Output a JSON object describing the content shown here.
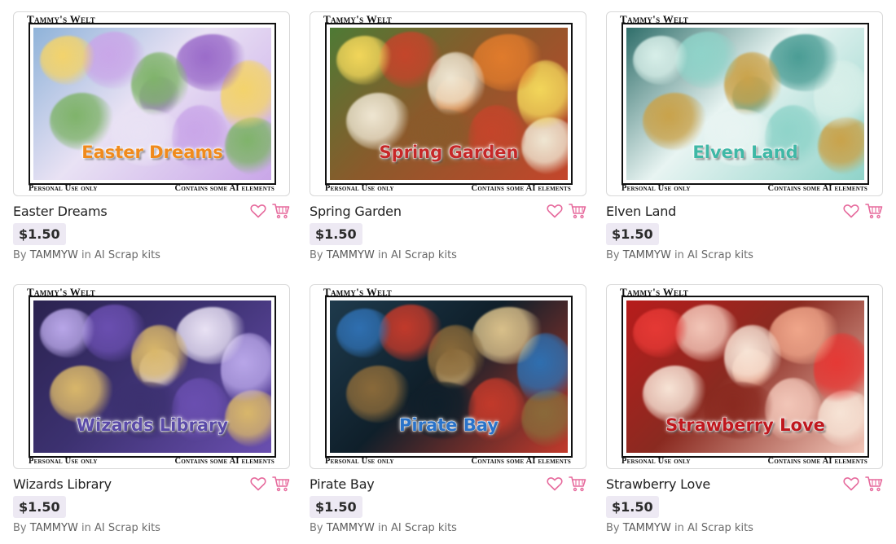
{
  "colors": {
    "accent": "#e6699c",
    "price_bg": "#ede9f3"
  },
  "products": [
    {
      "name": "Easter Dreams",
      "price": "$1.50",
      "by": "By",
      "author": "TAMMYW",
      "in": "in",
      "category": "AI Scrap kits",
      "brand": "Tammy's Welt",
      "note_left": "Personal Use only",
      "note_right": "Contains some AI elements",
      "art_title": "Easter Dreams",
      "art_title_color": "#f08a1c",
      "palette": [
        "#8fb3d9",
        "#c9a6e8",
        "#f3d36b",
        "#7fb36a",
        "#e9e2f4",
        "#9a6bc9"
      ]
    },
    {
      "name": "Spring Garden",
      "price": "$1.50",
      "by": "By",
      "author": "TAMMYW",
      "in": "in",
      "category": "AI Scrap kits",
      "brand": "Tammy's Welt",
      "note_left": "Personal Use only",
      "note_right": "Contains some AI elements",
      "art_title": "Spring Garden",
      "art_title_color": "#c62828",
      "palette": [
        "#4e7a35",
        "#c4452b",
        "#f2d65a",
        "#efe6d2",
        "#8a5a2b",
        "#e07b2c"
      ]
    },
    {
      "name": "Elven Land",
      "price": "$1.50",
      "by": "By",
      "author": "TAMMYW",
      "in": "in",
      "category": "AI Scrap kits",
      "brand": "Tammy's Welt",
      "note_left": "Personal Use only",
      "note_right": "Contains some AI elements",
      "art_title": "Elven Land",
      "art_title_color": "#3fb8a6",
      "palette": [
        "#2f6e6a",
        "#8fd3c9",
        "#d8efe9",
        "#c9a24a",
        "#e8f4f2",
        "#4a9c94"
      ]
    },
    {
      "name": "Wizards Library",
      "price": "$1.50",
      "by": "By",
      "author": "TAMMYW",
      "in": "in",
      "category": "AI Scrap kits",
      "brand": "Tammy's Welt",
      "note_left": "Personal Use only",
      "note_right": "Contains some AI elements",
      "art_title": "Wizards Library",
      "art_title_color": "#5a4aa8",
      "palette": [
        "#2b2350",
        "#6a4fb0",
        "#b8a6e8",
        "#d9b76a",
        "#3c3170",
        "#e9e2f4"
      ]
    },
    {
      "name": "Pirate Bay",
      "price": "$1.50",
      "by": "By",
      "author": "TAMMYW",
      "in": "in",
      "category": "AI Scrap kits",
      "brand": "Tammy's Welt",
      "note_left": "Personal Use only",
      "note_right": "Contains some AI elements",
      "art_title": "Pirate Bay",
      "art_title_color": "#2a73c9",
      "palette": [
        "#1e3a4c",
        "#c23a2b",
        "#2f6fb0",
        "#8a6a3a",
        "#0f1f2a",
        "#d9c08a"
      ]
    },
    {
      "name": "Strawberry Love",
      "price": "$1.50",
      "by": "By",
      "author": "TAMMYW",
      "in": "in",
      "category": "AI Scrap kits",
      "brand": "Tammy's Welt",
      "note_left": "Personal Use only",
      "note_right": "Contains some AI elements",
      "art_title": "Strawberry Love",
      "art_title_color": "#c0181e",
      "palette": [
        "#b71c1c",
        "#f2c6b8",
        "#e53935",
        "#f7e4d6",
        "#8a2a20",
        "#f0a68a"
      ]
    }
  ]
}
